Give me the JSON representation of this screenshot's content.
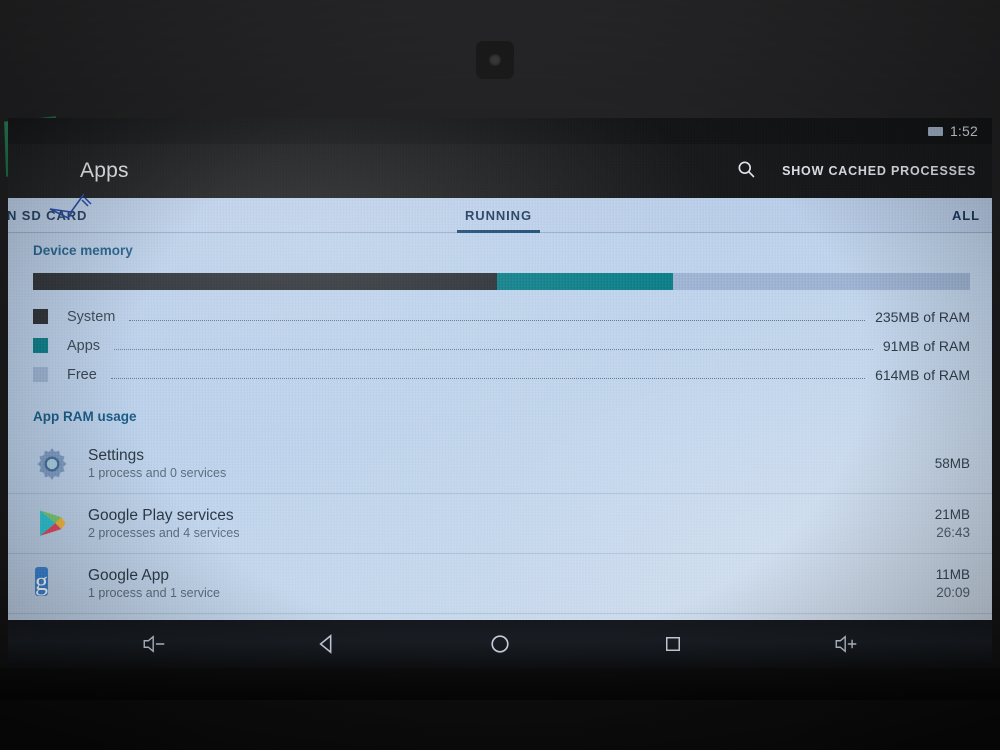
{
  "status_bar": {
    "battery_icon": "battery-icon",
    "time": "1:52"
  },
  "action_bar": {
    "title": "Apps",
    "search_icon": "search-icon",
    "cached_processes_label": "SHOW CACHED PROCESSES"
  },
  "tabs": [
    {
      "label": "ON SD CARD",
      "selected": false
    },
    {
      "label": "RUNNING",
      "selected": true
    },
    {
      "label": "ALL",
      "selected": false
    }
  ],
  "device_memory": {
    "header": "Device memory",
    "bar": {
      "system_pct": 49.5,
      "apps_pct": 18.8,
      "free_pct": 31.7
    },
    "legend": [
      {
        "label": "System",
        "value": "235MB of RAM",
        "color": "#282d33"
      },
      {
        "label": "Apps",
        "value": "91MB of RAM",
        "color": "#0b7b85"
      },
      {
        "label": "Free",
        "value": "614MB of RAM",
        "color": "#9cb2d2"
      }
    ]
  },
  "app_ram_usage": {
    "header": "App RAM usage",
    "apps": [
      {
        "name": "Settings",
        "subtitle": "1 process and 0 services",
        "memory": "58MB",
        "time": "",
        "icon": "settings-gear-icon"
      },
      {
        "name": "Google Play services",
        "subtitle": "2 processes and 4 services",
        "memory": "21MB",
        "time": "26:43",
        "icon": "google-play-services-icon"
      },
      {
        "name": "Google App",
        "subtitle": "1 process and 1 service",
        "memory": "11MB",
        "time": "20:09",
        "icon": "google-app-icon"
      }
    ]
  },
  "nav_bar": {
    "buttons": [
      {
        "name": "volume-down-icon",
        "label": "Volume down"
      },
      {
        "name": "back-icon",
        "label": "Back"
      },
      {
        "name": "home-icon",
        "label": "Home"
      },
      {
        "name": "recents-icon",
        "label": "Recent apps"
      },
      {
        "name": "volume-up-icon",
        "label": "Volume up"
      }
    ]
  },
  "colors": {
    "accent": "#1c5c86",
    "system": "#282d33",
    "apps": "#0b7b85",
    "free": "#9cb2d2",
    "tab_indicator": "#19486f"
  }
}
